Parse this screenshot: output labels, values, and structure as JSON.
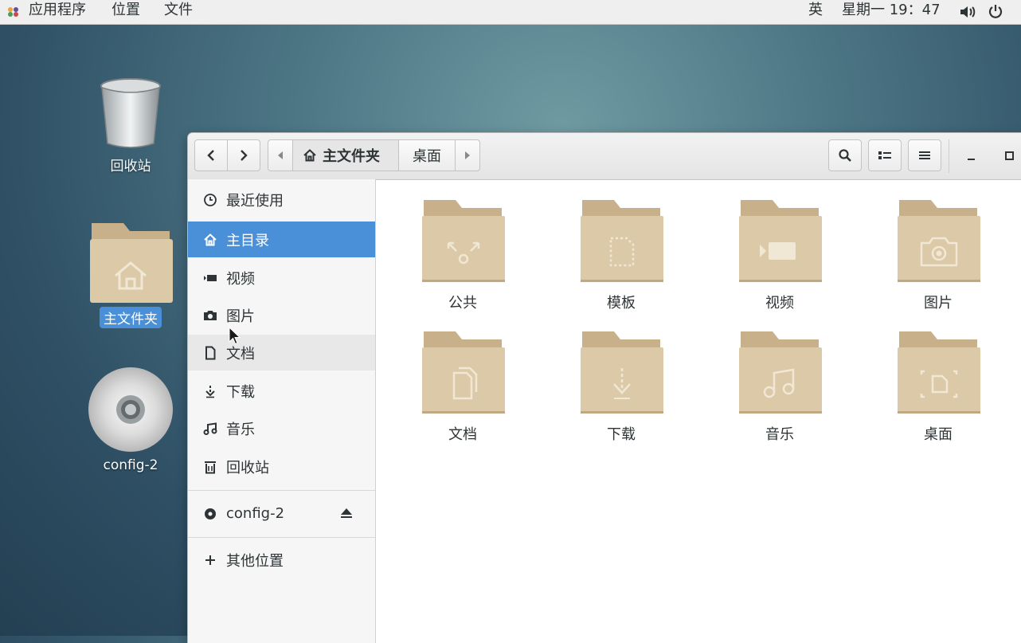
{
  "topbar": {
    "apps_label": "应用程序",
    "places_label": "位置",
    "files_label": "文件",
    "input_method": "英",
    "clock": "星期一 19：47"
  },
  "desktop": {
    "trash_label": "回收站",
    "home_label": "主文件夹",
    "disc_label": "config-2"
  },
  "window": {
    "path": {
      "home": "主文件夹",
      "desktop": "桌面"
    }
  },
  "sidebar": {
    "items": [
      {
        "label": "最近使用",
        "icon": "clock-icon"
      },
      {
        "label": "主目录",
        "icon": "home-icon"
      },
      {
        "label": "视频",
        "icon": "video-icon"
      },
      {
        "label": "图片",
        "icon": "camera-icon"
      },
      {
        "label": "文档",
        "icon": "document-icon"
      },
      {
        "label": "下载",
        "icon": "download-icon"
      },
      {
        "label": "音乐",
        "icon": "music-icon"
      },
      {
        "label": "回收站",
        "icon": "trash-icon"
      }
    ],
    "device": {
      "label": "config-2",
      "icon": "disc-icon"
    },
    "other": {
      "label": "其他位置",
      "icon": "plus-icon"
    }
  },
  "folders": [
    {
      "label": "公共",
      "icon": "share-icon"
    },
    {
      "label": "模板",
      "icon": "template-icon"
    },
    {
      "label": "视频",
      "icon": "video-icon"
    },
    {
      "label": "图片",
      "icon": "camera-icon"
    },
    {
      "label": "文档",
      "icon": "document-icon"
    },
    {
      "label": "下载",
      "icon": "download-icon"
    },
    {
      "label": "音乐",
      "icon": "music-icon"
    },
    {
      "label": "桌面",
      "icon": "desktop-icon"
    }
  ],
  "colors": {
    "accent": "#4a90d9",
    "folder": "#dcc9a8",
    "folder_tab": "#c8b08a"
  }
}
